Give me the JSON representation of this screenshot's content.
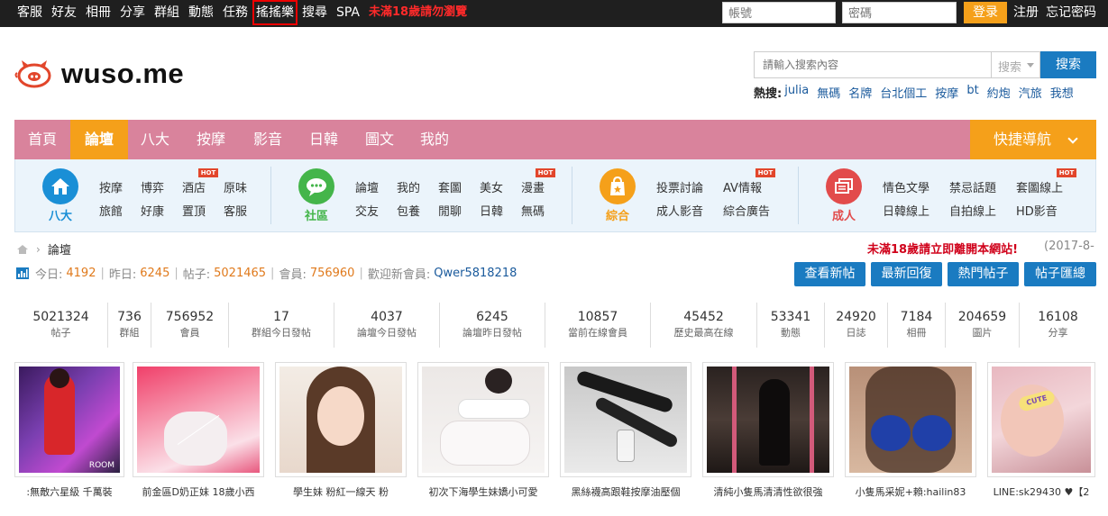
{
  "topbar": {
    "nav": [
      "客服",
      "好友",
      "相冊",
      "分享",
      "群組",
      "動態",
      "任務",
      "搖搖樂",
      "搜尋",
      "SPA"
    ],
    "warning": "未滿18歲請勿瀏覽",
    "username_placeholder": "帳號",
    "password_placeholder": "密碼",
    "login": "登录",
    "register": "注册",
    "forgot": "忘记密码"
  },
  "header": {
    "logo": "wuso.me",
    "search_placeholder": "請輸入搜索內容",
    "search_type": "搜索",
    "search_button": "搜索",
    "hot_label": "熱搜:",
    "hot_words": [
      "julia",
      "無碼",
      "名牌",
      "台北個工",
      "按摩",
      "bt",
      "約炮",
      "汽旅",
      "我想"
    ]
  },
  "mainnav": {
    "items": [
      "首頁",
      "論壇",
      "八大",
      "按摩",
      "影音",
      "日韓",
      "圖文",
      "我的"
    ],
    "active": "論壇",
    "quick": "快捷導航"
  },
  "subnav": {
    "groups": [
      {
        "label": "八大",
        "color": "#1a8fd6",
        "links": [
          "按摩",
          "博弈",
          "酒店",
          "原味",
          "旅館",
          "好康",
          "置頂",
          "客服"
        ],
        "hot": "HOT"
      },
      {
        "label": "社區",
        "color": "#44b54a",
        "links": [
          "論壇",
          "我的",
          "套圖",
          "美女",
          "漫畫",
          "交友",
          "包養",
          "閒聊",
          "日韓",
          "無碼"
        ],
        "hot": "HOT"
      },
      {
        "label": "綜合",
        "color": "#f5a01a",
        "links": [
          "投票討論",
          "AV情報",
          "成人影音",
          "綜合廣告"
        ],
        "hot": "HOT"
      },
      {
        "label": "成人",
        "color": "#e24b4b",
        "links": [
          "情色文學",
          "禁忌話題",
          "套圖線上",
          "日韓線上",
          "自拍線上",
          "HD影音"
        ],
        "hot": "HOT"
      }
    ]
  },
  "breadcrumb": {
    "current": "論壇"
  },
  "notice": "未滿18歲請立即離開本網站!",
  "date": "(2017-8-",
  "stats": {
    "today_label": "今日:",
    "today": "4192",
    "yesterday_label": "昨日:",
    "yesterday": "6245",
    "posts_label": "帖子:",
    "posts": "5021465",
    "members_label": "會員:",
    "members": "756960",
    "welcome_label": "歡迎新會員:",
    "newest": "Qwer5818218"
  },
  "actions": [
    "查看新帖",
    "最新回復",
    "熱門帖子",
    "帖子匯總"
  ],
  "counters": [
    {
      "v": "5021324",
      "l": "帖子"
    },
    {
      "v": "736",
      "l": "群組"
    },
    {
      "v": "756952",
      "l": "會員"
    },
    {
      "v": "17",
      "l": "群組今日發帖"
    },
    {
      "v": "4037",
      "l": "論壇今日發帖"
    },
    {
      "v": "6245",
      "l": "論壇昨日發帖"
    },
    {
      "v": "10857",
      "l": "當前在線會員"
    },
    {
      "v": "45452",
      "l": "歷史最高在線"
    },
    {
      "v": "53341",
      "l": "動態"
    },
    {
      "v": "24920",
      "l": "日誌"
    },
    {
      "v": "7184",
      "l": "相冊"
    },
    {
      "v": "204659",
      "l": "圖片"
    },
    {
      "v": "16108",
      "l": "分享"
    }
  ],
  "gallery": [
    {
      "cap": ":無敵六星級 千萬裝"
    },
    {
      "cap": "前金區D奶正妹 18歲小西"
    },
    {
      "cap": "學生妹 粉紅一線天 粉"
    },
    {
      "cap": "初次下海學生妹嬌小可愛"
    },
    {
      "cap": "黑絲襪高跟鞋按摩油壓個"
    },
    {
      "cap": "清純小隻馬清清性欲很強"
    },
    {
      "cap": "小隻馬采妮+賴:hailin83"
    },
    {
      "cap": "LINE:sk29430 ♥【2"
    }
  ],
  "gallery_overlay": [
    "ROOM",
    "CUTE"
  ]
}
